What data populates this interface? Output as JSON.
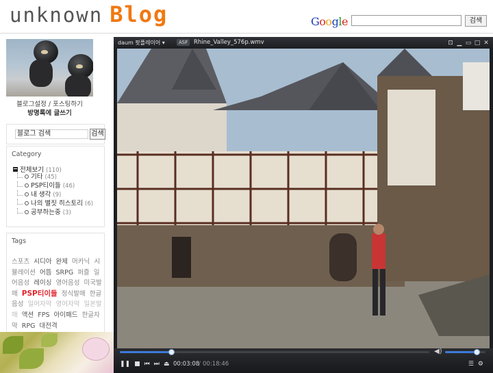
{
  "header": {
    "logo_part1": "unknown",
    "logo_part2": "Blog",
    "google_letters": [
      {
        "ch": "G",
        "color": "#1a3fb5"
      },
      {
        "ch": "o",
        "color": "#d32a1f"
      },
      {
        "ch": "o",
        "color": "#e6a414"
      },
      {
        "ch": "g",
        "color": "#1a3fb5"
      },
      {
        "ch": "l",
        "color": "#2a9b32"
      },
      {
        "ch": "e",
        "color": "#d32a1f"
      }
    ],
    "search_value": "",
    "search_button": "검색"
  },
  "sidebar": {
    "links_line1": "블로그설정 / 포스팅하기",
    "links_line2": "방명록에 글쓰기",
    "blog_search_value": "블로그 검색",
    "blog_search_button": "검색",
    "category": {
      "title": "Category",
      "root_label": "전체보기",
      "root_count": "(110)",
      "items": [
        {
          "label": "기타",
          "count": "(45)"
        },
        {
          "label": "PSP티이들",
          "count": "(46)"
        },
        {
          "label": "내 생각",
          "count": "(9)"
        },
        {
          "label": "나의 별짓 히스토리",
          "count": "(6)"
        },
        {
          "label": "공부하는중",
          "count": "(3)"
        }
      ]
    },
    "tags": {
      "title": "Tags",
      "items": [
        {
          "text": "스포츠",
          "style": "t1"
        },
        {
          "text": "시디아",
          "style": "t2"
        },
        {
          "text": "완제",
          "style": "t2"
        },
        {
          "text": "머카닉",
          "style": "t1"
        },
        {
          "text": "시뮬레이션",
          "style": "t1"
        },
        {
          "text": "어뜸",
          "style": "t2"
        },
        {
          "text": "SRPG",
          "style": "t2"
        },
        {
          "text": "퍼즐",
          "style": "t1"
        },
        {
          "text": "일어음성",
          "style": "t1"
        },
        {
          "text": "레이싱",
          "style": "t2"
        },
        {
          "text": "영어음성",
          "style": "t1"
        },
        {
          "text": "미국발매",
          "style": "t1"
        },
        {
          "text": "PSP티이들",
          "style": "hot"
        },
        {
          "text": "정식발매",
          "style": "t1"
        },
        {
          "text": "한글음성",
          "style": "t1"
        },
        {
          "text": "일어자막",
          "style": "t3"
        },
        {
          "text": "영어자막",
          "style": "t3"
        },
        {
          "text": "일본발매",
          "style": "t3"
        },
        {
          "text": "액션",
          "style": "t2"
        },
        {
          "text": "FPS",
          "style": "t2"
        },
        {
          "text": "아이패드",
          "style": "t2"
        },
        {
          "text": "한글자막",
          "style": "t1"
        },
        {
          "text": "RPG",
          "style": "t2"
        },
        {
          "text": "대전격",
          "style": "t2"
        }
      ]
    }
  },
  "player": {
    "brand": "daum 팟플레이어",
    "format": "ASF",
    "filename": "Rhine_Valley_576p.wmv",
    "time_current": "00:03:08",
    "time_separator": "/",
    "time_total": "00:18:46",
    "progress_fraction": 0.167,
    "volume_fraction": 0.78,
    "colors": {
      "accent": "#3d7ad8",
      "chrome": "#1d1f23"
    }
  }
}
